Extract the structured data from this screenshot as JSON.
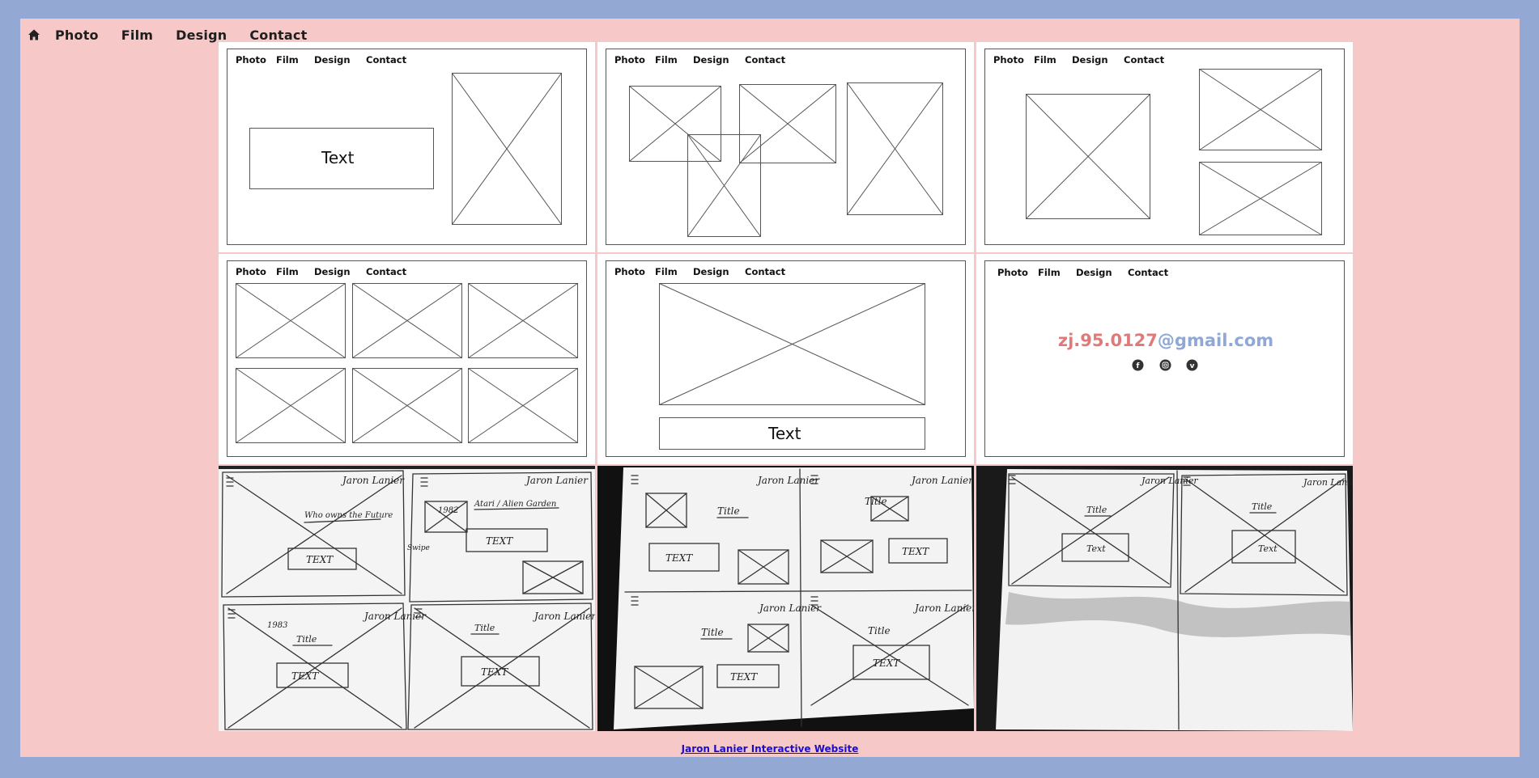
{
  "topnav": {
    "home_icon": "home-icon",
    "links": [
      "Photo",
      "Film",
      "Design",
      "Contact"
    ]
  },
  "wireframe_nav": [
    "Photo",
    "Film",
    "Design",
    "Contact"
  ],
  "wireframes": {
    "hero_text": "Text",
    "detail_text": "Text",
    "contact_email_user": "zj.95.0127",
    "contact_email_domain": "@gmail.com",
    "social_icons": [
      "facebook-icon",
      "instagram-icon",
      "vimeo-icon"
    ]
  },
  "sketches": {
    "sheet1": {
      "panel1": {
        "name": "Jaron Lanier",
        "title": "Who owns the Future",
        "text": "TEXT"
      },
      "panel2": {
        "name": "Jaron Lanier",
        "year": "1982",
        "title": "Atari / Alien Garden",
        "swipe": "Swipe",
        "text": "TEXT"
      },
      "panel3": {
        "name": "Jaron Lanier",
        "year": "1983",
        "title": "Title",
        "text": "TEXT"
      },
      "panel4": {
        "name": "Jaron Lanier",
        "title": "Title",
        "text": "TEXT"
      }
    },
    "sheet2": {
      "panel1": {
        "name": "Jaron Lanier",
        "title": "Title",
        "text": "TEXT"
      },
      "panel2": {
        "name": "Jaron Lanier",
        "title": "Title",
        "text": "TEXT"
      },
      "panel3": {
        "name": "Jaron Lanier",
        "title": "Title",
        "text": "TEXT"
      },
      "panel4": {
        "name": "Jaron Lanier",
        "title": "Title",
        "text": "TEXT"
      }
    },
    "sheet3": {
      "panel1": {
        "name": "Jaron Lanier",
        "title": "Title",
        "text": "Text"
      },
      "panel2": {
        "name": "Jaron Lanier",
        "title": "Title",
        "text": "Text"
      }
    }
  },
  "footer": {
    "link": "Jaron Lanier Interactive Website"
  },
  "colors": {
    "frame": "#93a8d2",
    "page": "#f6c8c8",
    "email_user": "#e07a7a",
    "email_domain": "#8fa8d6",
    "link": "#1a0dcc"
  }
}
